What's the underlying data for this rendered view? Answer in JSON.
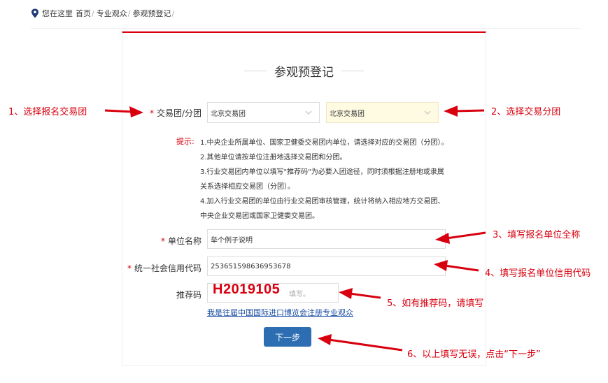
{
  "breadcrumb": {
    "prefix": "您在这里",
    "items": [
      "首页",
      "专业观众",
      "参观预登记"
    ]
  },
  "form": {
    "title": "参观预登记",
    "trade_group": {
      "label": "交易团/分团",
      "required_mark": "*",
      "group_value": "北京交易团",
      "subgroup_value": "北京交易团"
    },
    "tips": {
      "label": "提示:",
      "lines": [
        "1.中央企业所属单位、国家卫健委交易团内单位，请选择对应的交易团（分团）。",
        "2.其他单位请按单位注册地选择交易团和分团。",
        "3.行业交易团内单位以填写\"推荐码\"为必要入团途径，同时须根据注册地或隶属",
        "关系选择相应交易团（分团）。",
        "4.加入行业交易团的单位由行业交易团审核管理，统计将纳入相应地方交易团、",
        "中央企业交易团或国家卫健委交易团。"
      ]
    },
    "company_name": {
      "label": "单位名称",
      "required_mark": "*",
      "value": "举个例子说明"
    },
    "credit_code": {
      "label": "统一社会信用代码",
      "required_mark": "*",
      "value": "253651598636953678"
    },
    "referral": {
      "label": "推荐码",
      "placeholder_tail": "填写。",
      "overlay_value": "H2019105"
    },
    "link_text": "我是往届中国国际进口博览会注册专业观众",
    "next_button": "下一步"
  },
  "annotations": [
    "1、选择报名交易团",
    "2、选择交易分团",
    "3、填写报名单位全称",
    "4、填写报名单位信用代码",
    "5、如有推荐码，请填写",
    "6、以上填写无误，点击“下一步”"
  ],
  "colors": {
    "accent_red": "#d8000f",
    "button_blue": "#2d6eb2",
    "link_blue": "#1a4ea5",
    "highlight_bg": "#fffbe3"
  },
  "icons": {
    "breadcrumb": "location-pin-icon",
    "select": "chevron-down-icon"
  }
}
